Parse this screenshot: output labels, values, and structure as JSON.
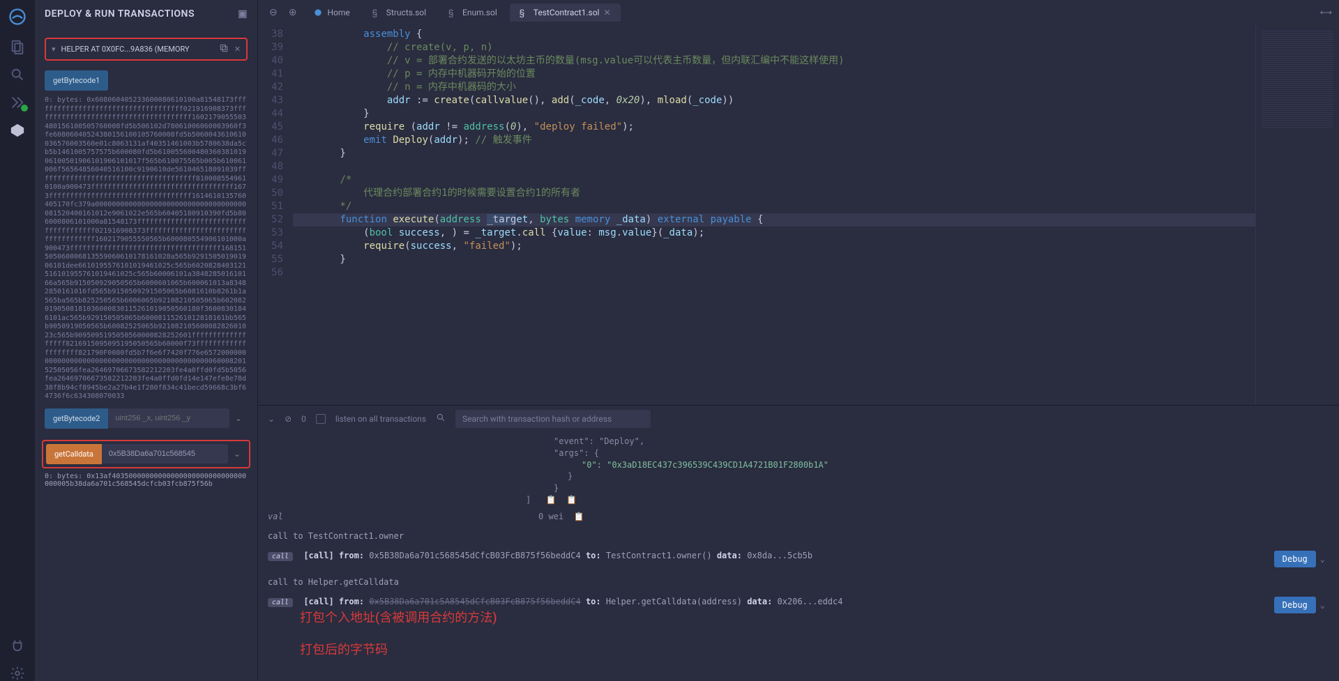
{
  "panel": {
    "title": "DEPLOY & RUN TRANSACTIONS",
    "contract_label": "HELPER AT 0X0FC...9A836 (MEMORY",
    "getBytecode1_label": "getBytecode1",
    "bytecode1_output": "0: bytes: 0x608060405233600080610100a81548173ffffffffffffffffffffffffffffffffffff021916908373ffffffffffffffffffffffffffffffffffffff1602179055503480156100505760008fd5b506102d78061006060003960f3fe60806040524380156100105760008fd5b5060043610610036576003560e01c8063131af40351461003b5780638da5cb5b1461005757575b600080fd5b61005560048036038101906100501906101906101017f565b610075565b005b610061006f56564856040516100c9190610de561046518091039ffffffffffffffffffffffffffffffffffffff8100085549610100a900473ffffffffffffffffffffffffffffffffff1673ffffffffffffffffffffffffffffffffff1614610135760405170fc379a000000000000000000000000000000000000081520400161012e9061022e565b60405180910390fd5b806000806101000a81548173ffffffffffffffffffffffffffffffffffffff021916908373ffffffffffffffffffffffffffffffffffff1602179055550565b600080554906101000a900473ffffffffffffffffffffffffffffffffffff168151505060006813559060610178161028a565b929150501901906101dee6610195576101019461025c565b6020828403121516101955761019461025c565b60006101a384828501610166a565b915050929050565b6000601065b600061013a83482850161016fd565b9150509291505065b6081610b8261b1a565ba565b825250565b6006065b92108210505065b6020820190508181036000830115261019050560180f36008301846101ac565b929150505065b60008115261012818161bb565b9050919050565b60082525065b92108210560008282601023c565b9095095195050560000828252601ffffffffffffffffff8216915095095195050565b60000f73ffffffffffffffffffff821790F0080fd5b7f6e6f7420f776e657200000000000000000000000000000000000000000000006000820152505056fea26469706673582212203fe4a0ffd0fd5b5056fea26469706673582212203fe4a0ffd0fd14e147efe8e78d38f8b94cf8945be2a27b4e1f280f834c41becd59668c3bf64736f6c634308070033",
    "getBytecode2_label": "getBytecode2",
    "getBytecode2_placeholder": "uint256 _x, uint256 _y",
    "getCalldata_label": "getCalldata",
    "getCalldata_value": "0x5B38Da6a701c568545",
    "getCalldata_output": "0: bytes: 0x13af40350000000000000000000000000000000005b38da6a701c568545dcfcb03fcb875f56b"
  },
  "tabs": {
    "home": "Home",
    "t1": "Structs.sol",
    "t2": "Enum.sol",
    "t3": "TestContract1.sol"
  },
  "code_lines": [
    {
      "n": 38,
      "html": "            <span class='kw'>assembly</span> {"
    },
    {
      "n": 39,
      "html": "                <span class='cm'>// create(v, p, n)</span>"
    },
    {
      "n": 40,
      "html": "                <span class='cm'>// v = 部署合约发送的以太坊主币的数量(msg.value可以代表主币数量，但内联汇编中不能这样使用)</span>"
    },
    {
      "n": 41,
      "html": "                <span class='cm'>// p = 内存中机器码开始的位置</span>"
    },
    {
      "n": 42,
      "html": "                <span class='cm'>// n = 内存中机器码的大小</span>"
    },
    {
      "n": 43,
      "html": "                <span class='id'>addr</span> := <span class='fn'>create</span>(<span class='fn'>callvalue</span>(), <span class='fn'>add</span>(<span class='id'>_code</span>, <span class='num'>0x20</span>), <span class='fn'>mload</span>(<span class='id'>_code</span>))"
    },
    {
      "n": 44,
      "html": "            }"
    },
    {
      "n": 45,
      "html": "            <span class='fn'>require</span> (<span class='id'>addr</span> != <span class='ty'>address</span>(<span class='num'>0</span>), <span class='str'>\"deploy failed\"</span>);"
    },
    {
      "n": 46,
      "html": "            <span class='kw'>emit</span> <span class='fn'>Deploy</span>(<span class='id'>addr</span>); <span class='cm'>// 触发事件</span>"
    },
    {
      "n": 47,
      "html": "        }"
    },
    {
      "n": 48,
      "html": ""
    },
    {
      "n": 49,
      "html": "        <span class='cm'>/*</span>"
    },
    {
      "n": 50,
      "html": "        <span class='cm'>    代理合约部署合约1的时候需要设置合约1的所有者</span>"
    },
    {
      "n": 51,
      "html": "        <span class='cm'>*/</span>"
    },
    {
      "n": 52,
      "html": "        <span class='kw'>function</span> <span class='fn'>execute</span>(<span class='ty'>address</span> <span class='sel'>_targ</span><span class='id'>et</span>, <span class='ty'>bytes</span> <span class='kw'>memory</span> <span class='id'>_data</span>) <span class='kw'>external</span> <span class='kw'>payable</span> {",
      "cls": "hl-line"
    },
    {
      "n": 53,
      "html": "            (<span class='ty'>bool</span> <span class='id'>success</span>, ) = <span class='id'>_target</span>.<span class='fn'>call</span> {<span class='id'>value</span>: <span class='id'>msg</span>.<span class='id'>value</span>}(<span class='id'>_data</span>);"
    },
    {
      "n": 54,
      "html": "            <span class='fn'>require</span>(<span class='id'>success</span>, <span class='str'>\"failed\"</span>);"
    },
    {
      "n": 55,
      "html": "        }"
    },
    {
      "n": 56,
      "html": ""
    }
  ],
  "termbar": {
    "listen": "listen on all transactions",
    "search_placeholder": "Search with transaction hash or address",
    "count": "0"
  },
  "terminal": {
    "json_event": "\"event\": \"Deploy\",",
    "json_args": "\"args\": {",
    "json_arg0": "\"0\": \"0x3aD18EC437c396539C439CD1A4721B01F2800b1A\"",
    "val_label": "val",
    "val_value": "0 wei",
    "call_owner": "call to TestContract1.owner",
    "line1_from": "0x5B38Da6a701c568545dCfcB03FcB875f56beddC4",
    "line1_to": "TestContract1.owner()",
    "line1_data": "0x8da...5cb5b",
    "call_helper": "call to Helper.getCalldata",
    "line2_from": "0x5B38Da6a701c5A8545dCfcB03FcB875f56beddC4",
    "line2_to": "Helper.getCalldata(address)",
    "line2_data": "0x206...eddc4",
    "debug": "Debug",
    "call_tag": "[call]",
    "from_lbl": "from:",
    "to_lbl": "to:",
    "data_lbl": "data:"
  },
  "annotations": {
    "a1": "打包个入地址(含被调用合约的方法)",
    "a2": "打包后的字节码"
  }
}
